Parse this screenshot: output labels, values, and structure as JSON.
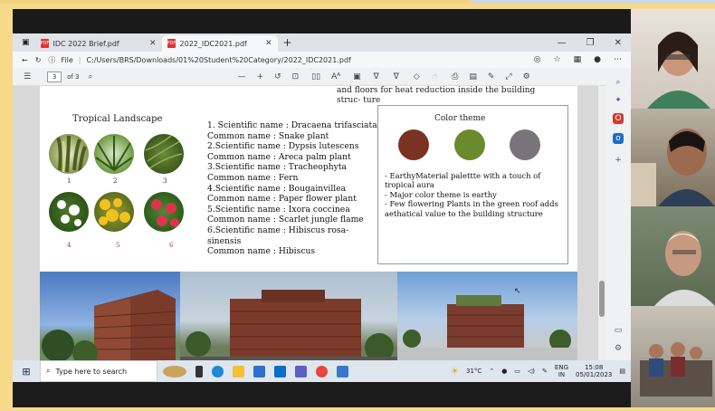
{
  "browser": {
    "tabs": [
      {
        "label": "IDC 2022 Brief.pdf",
        "active": false
      },
      {
        "label": "2022_IDC2021.pdf",
        "active": true
      }
    ],
    "address_prefix": "File",
    "address": "C:/Users/BRS/Downloads/01%20Student%20Category/2022_IDC2021.pdf"
  },
  "pdf_toolbar": {
    "page_number": "3",
    "page_total": "of 3"
  },
  "page": {
    "intro_text": "and floors for heat reduction inside the building struc- ture",
    "tropical_title": "Tropical Landscape",
    "plant_numbers": [
      "1",
      "2",
      "3",
      "4",
      "5",
      "6"
    ],
    "species_lines": [
      "1. Scientific name : Dracaena trifasciata",
      "Common name : Snake plant",
      "2.Scientific name : Dypsis lutescens",
      "Common name : Areca palm plant",
      "3.Scientific name : Tracheophyta",
      "Common name : Fern",
      "4.Scientific name : Bougainvillea",
      "Common name : Paper flower plant",
      "5.Scientific name : Ixora coccinea",
      "Common name : Scarlet jungle flame",
      "6.Scientific name : Hibiscus rosa-sinensis",
      "Common name : Hibiscus"
    ],
    "color_theme_title": "Color theme",
    "color_swatches": [
      "#7a3322",
      "#6b8a2e",
      "#77757a"
    ],
    "color_notes": [
      "- EarthyMaterial palettte with a touch of tropical aura",
      "- Major color theme is earthy",
      "- Few flowering Plants in the green roof adds aethatical value to the building structure"
    ]
  },
  "taskbar": {
    "search_placeholder": "Type here to search",
    "weather": "31°C",
    "language": "ENG",
    "region": "IN",
    "time": "15:08",
    "date": "05/01/2023"
  }
}
